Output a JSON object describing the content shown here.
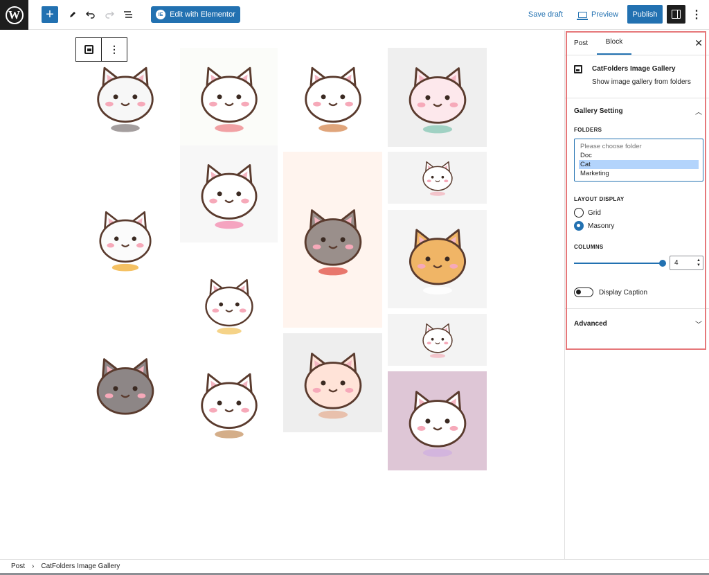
{
  "topbar": {
    "logo_letter": "W",
    "add_icon": "plus-icon",
    "tools_icon": "pencil-icon",
    "undo_icon": "undo-icon",
    "redo_icon": "redo-icon",
    "outline_icon": "list-view-icon",
    "elementor_label": "Edit with Elementor",
    "elementor_badge": "IE",
    "save_draft": "Save draft",
    "preview": "Preview",
    "publish": "Publish",
    "more": "⋮"
  },
  "block_toolbar": {
    "more": "⋮"
  },
  "breadcrumb": {
    "root": "Post",
    "separator": "›",
    "current": "CatFolders Image Gallery"
  },
  "sidebar": {
    "tabs": {
      "post": "Post",
      "block": "Block"
    },
    "close": "✕",
    "block_title": "CatFolders Image Gallery",
    "block_desc": "Show image gallery from folders",
    "gallery_setting": "Gallery Setting",
    "folders_label": "FOLDERS",
    "folder_options": [
      "Please choose folder",
      "Doc",
      "Cat",
      "Marketing"
    ],
    "folder_selected": "Cat",
    "layout_label": "LAYOUT DISPLAY",
    "layout_options": [
      "Grid",
      "Masonry"
    ],
    "layout_selected": "Masonry",
    "columns_label": "COLUMNS",
    "columns_value": "4",
    "display_caption": "Display Caption",
    "advanced": "Advanced"
  },
  "gallery": {
    "tiles": [
      {
        "name": "gallery-image-cat-hug",
        "bg": "#ffffff",
        "cat": "#f7f7f7",
        "accent": "#8d8686"
      },
      {
        "name": "gallery-image-cat-cushion",
        "bg": "#fbfcf9",
        "cat": "#ffffff",
        "accent": "#ef8a8f"
      },
      {
        "name": "gallery-image-cat-stretch",
        "bg": "#ffffff",
        "cat": "#ffffff",
        "accent": "#d88f5a"
      },
      {
        "name": "gallery-image-cat-mug",
        "bg": "#efefef",
        "cat": "#fde8ec",
        "accent": "#8cc9b8"
      },
      {
        "name": "gallery-image-cat-bow",
        "bg": "#f7f7f7",
        "cat": "#ffffff",
        "accent": "#f48fb1"
      },
      {
        "name": "gallery-image-cat-gray-heart",
        "bg": "#fff4ee",
        "cat": "#9a8f8b",
        "accent": "#e2574c"
      },
      {
        "name": "gallery-image-cat-small-1",
        "bg": "#f3f3f3",
        "cat": "#ffffff",
        "accent": "#f2b8c0"
      },
      {
        "name": "gallery-image-cat-snack",
        "bg": "#ffffff",
        "cat": "#fbfbfb",
        "accent": "#f3b23c"
      },
      {
        "name": "gallery-image-cat-orange",
        "bg": "#f4f4f4",
        "cat": "#f0b566",
        "accent": "#ffffff"
      },
      {
        "name": "gallery-image-cat-bag",
        "bg": "#ffffff",
        "cat": "#ffffff",
        "accent": "#f2c86a"
      },
      {
        "name": "gallery-image-cat-small-2",
        "bg": "#f3f3f3",
        "cat": "#ffffff",
        "accent": "#f2b8c0"
      },
      {
        "name": "gallery-image-cat-lying",
        "bg": "#eeeeee",
        "cat": "#ffe3d8",
        "accent": "#e6b49b"
      },
      {
        "name": "gallery-image-cat-phone",
        "bg": "#ffffff",
        "cat": "#8d8686",
        "accent": "#ffffff"
      },
      {
        "name": "gallery-image-cat-boba",
        "bg": "#ffffff",
        "cat": "#ffffff",
        "accent": "#c99a6b"
      },
      {
        "name": "gallery-image-cat-pink-bg",
        "bg": "#dec6d6",
        "cat": "#ffffff",
        "accent": "#cfb0e0"
      }
    ]
  }
}
